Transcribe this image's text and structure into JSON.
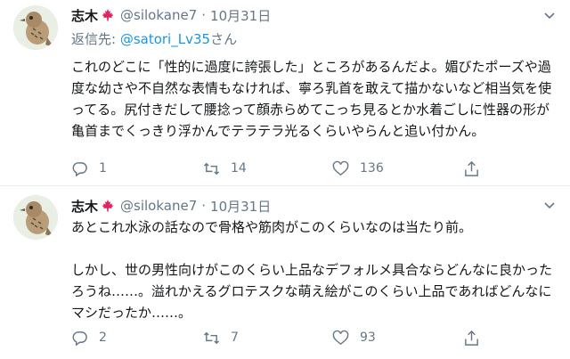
{
  "tweets": [
    {
      "author": {
        "name": "志木",
        "handle": "@silokane7",
        "flag_icon": "maple-leaf-icon"
      },
      "date": "10月31日",
      "separator": "·",
      "reply_to": {
        "prefix": "返信先: ",
        "mention": "@satori_Lv35",
        "suffix": "さん"
      },
      "text": "これのどこに「性的に過度に誇張した」ところがあるんだよ。媚びたポーズや過度な幼さや不自然な表情もなければ、寧ろ乳首を敢えて描かないなど相当気を使ってる。尻付きだして腰捻って顔赤らめてこっち見るとか水着ごしに性器の形が亀首までくっきり浮かんでテラテラ光るくらいやらんと追い付かん。",
      "stats": {
        "replies": "1",
        "retweets": "14",
        "likes": "136"
      }
    },
    {
      "author": {
        "name": "志木",
        "handle": "@silokane7",
        "flag_icon": "maple-leaf-icon"
      },
      "date": "10月31日",
      "separator": "·",
      "text": "あとこれ水泳の話なので骨格や筋肉がこのくらいなのは当たり前。\n\nしかし、世の男性向けがこのくらい上品なデフォルメ具合ならどんなに良かったろうね……。溢れかえるグロテスクな萌え絵がこのくらい上品であればどんなにマシだったか……。",
      "stats": {
        "replies": "2",
        "retweets": "7",
        "likes": "93"
      }
    }
  ],
  "colors": {
    "link": "#1b95e0",
    "muted": "#657786",
    "flag": "#e0245e"
  }
}
